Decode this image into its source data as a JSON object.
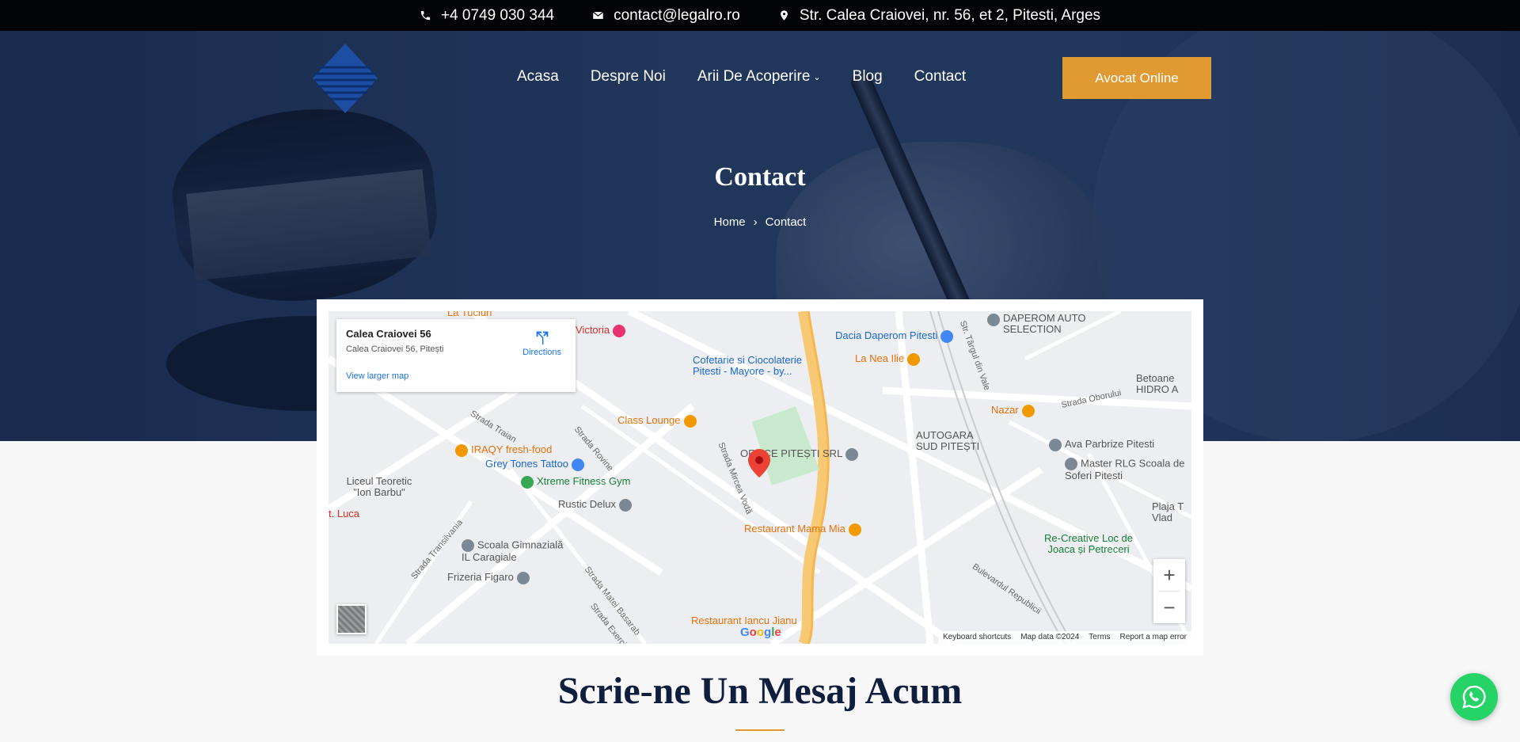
{
  "topbar": {
    "phone": "+4 0749 030 344",
    "email": "contact@legalro.ro",
    "address": "Str. Calea Craiovei, nr. 56, et 2, Pitesti, Arges"
  },
  "nav": {
    "items": [
      {
        "label": "Acasa"
      },
      {
        "label": "Despre Noi"
      },
      {
        "label": "Arii De Acoperire",
        "dropdown": true
      },
      {
        "label": "Blog"
      },
      {
        "label": "Contact"
      }
    ],
    "cta_label": "Avocat Online"
  },
  "hero": {
    "title": "Contact",
    "breadcrumb": {
      "home": "Home",
      "separator": "›",
      "current": "Contact"
    }
  },
  "map": {
    "info": {
      "title": "Calea Craiovei 56",
      "address": "Calea Craiovei 56, Pitești",
      "directions": "Directions",
      "larger_map": "View larger map"
    },
    "pois": [
      {
        "label": "La Tuciuri",
        "color": "orange"
      },
      {
        "label": "Victoria",
        "color": "red"
      },
      {
        "label": "DAPEROM AUTO SELECTION",
        "color": "grey"
      },
      {
        "label": "Dacia Daperom Pitesti",
        "color": "blue"
      },
      {
        "label": "Cofetarie si Ciocolaterie Pitesti - Mayore - by...",
        "color": "blue"
      },
      {
        "label": "La Nea Ilie",
        "color": "orange"
      },
      {
        "label": "Betoane HIDRO A",
        "color": "grey"
      },
      {
        "label": "Class Lounge",
        "color": "orange"
      },
      {
        "label": "Nazar",
        "color": "orange"
      },
      {
        "label": "AUTOGARA SUD PITEȘTI",
        "color": "grey"
      },
      {
        "label": "Ava Parbrize Pitesti",
        "color": "grey"
      },
      {
        "label": "Master RLG Scoala de Soferi Pitesti",
        "color": "grey"
      },
      {
        "label": "IRAQY fresh-food",
        "color": "orange"
      },
      {
        "label": "Grey Tones Tattoo",
        "color": "blue"
      },
      {
        "label": "OFFICE PITEȘTI SRL",
        "color": "grey"
      },
      {
        "label": "Xtreme Fitness Gym",
        "color": "green"
      },
      {
        "label": "Liceul Teoretic \"Ion Barbu\"",
        "color": "grey"
      },
      {
        "label": "Rustic Delux",
        "color": "grey"
      },
      {
        "label": "Restaurant Mama Mia",
        "color": "orange"
      },
      {
        "label": "Plaja T Vlad",
        "color": "grey"
      },
      {
        "label": "Re-Creative Loc de Joaca și Petreceri",
        "color": "green"
      },
      {
        "label": "Scoala Gimnazială IL Caragiale",
        "color": "grey"
      },
      {
        "label": "Frizeria Figaro",
        "color": "grey"
      },
      {
        "label": "Restaurant Iancu Jianu",
        "color": "orange"
      },
      {
        "label": "t. Luca",
        "color": "red"
      }
    ],
    "streets": [
      "Strada Traian",
      "Strada Rovine",
      "Strada Mircea Vodă",
      "Strada Transilvania",
      "Strada Matei Basarab",
      "Strada Exercitiu",
      "Str. Târgul din Vale",
      "Strada Oborului",
      "Bulevardul Republicii"
    ],
    "zoom_in": "+",
    "zoom_out": "−",
    "attribution": [
      "Keyboard shortcuts",
      "Map data ©2024",
      "Terms",
      "Report a map error"
    ],
    "google": "Google"
  },
  "section": {
    "title": "Scrie-ne Un Mesaj Acum"
  },
  "colors": {
    "accent": "#e19a32",
    "navy": "#101e3e",
    "whatsapp": "#25d366"
  }
}
